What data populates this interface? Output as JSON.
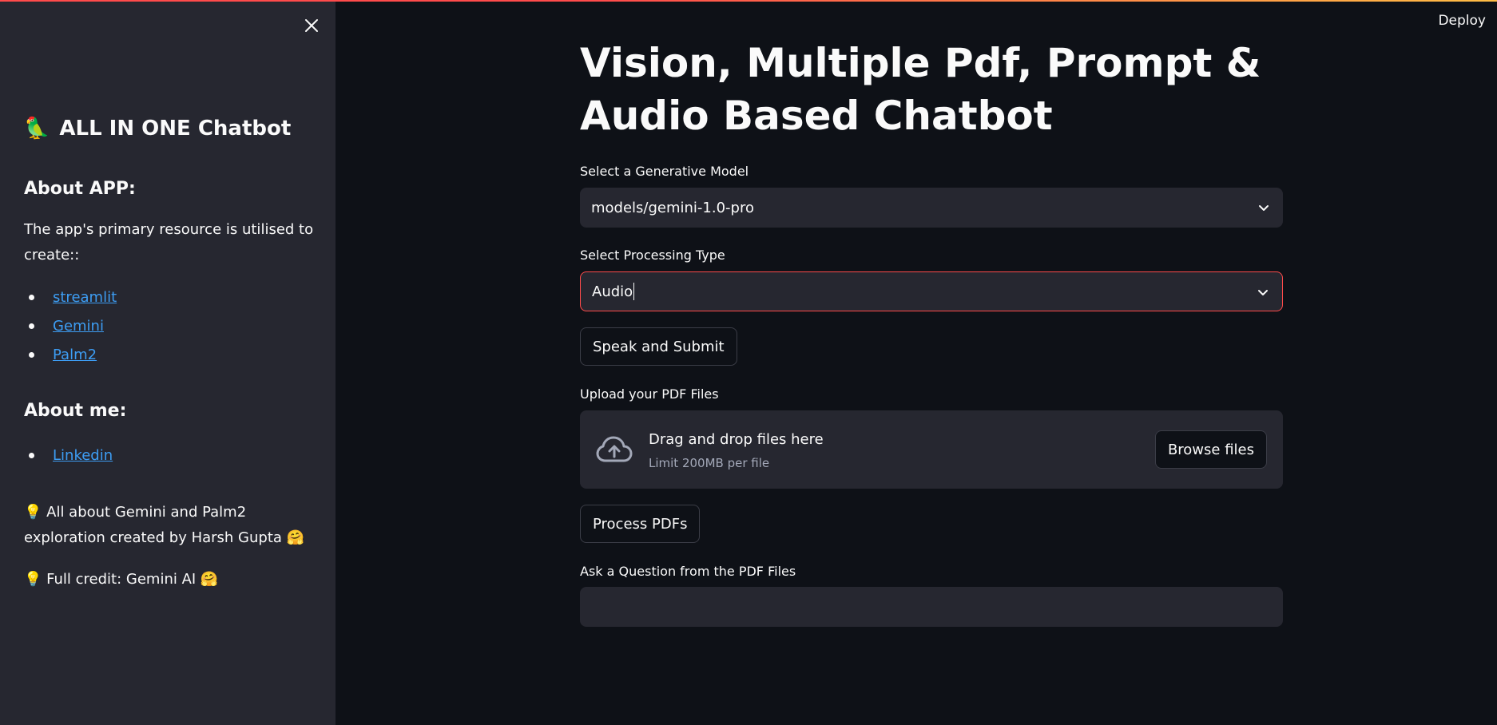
{
  "sidebar": {
    "title": "ALL IN ONE Chatbot",
    "title_emoji": "🦜",
    "about_app_heading": "About APP:",
    "about_app_text": "The app's primary resource is utilised to create::",
    "resource_links": [
      "streamlit",
      "Gemini",
      "Palm2"
    ],
    "about_me_heading": "About me:",
    "about_me_links": [
      "Linkedin"
    ],
    "note_1": "💡 All about Gemini and Palm2 exploration created by Harsh Gupta 🤗",
    "note_2": "💡 Full credit: Gemini AI 🤗"
  },
  "header": {
    "deploy_label": "Deploy"
  },
  "main": {
    "title": "Vision, Multiple Pdf, Prompt & Audio Based Chatbot",
    "model_select": {
      "label": "Select a Generative Model",
      "value": "models/gemini-1.0-pro"
    },
    "processing_select": {
      "label": "Select Processing Type",
      "value": "Audio"
    },
    "speak_button": "Speak and Submit",
    "upload": {
      "label": "Upload your PDF Files",
      "drag_text": "Drag and drop files here",
      "limit_text": "Limit 200MB per file",
      "browse_button": "Browse files"
    },
    "process_button": "Process PDFs",
    "question": {
      "label": "Ask a Question from the PDF Files",
      "value": ""
    }
  },
  "colors": {
    "background": "#0e1117",
    "sidebar": "#262730",
    "accent": "#ff4b4b",
    "link": "#3d9df3"
  }
}
